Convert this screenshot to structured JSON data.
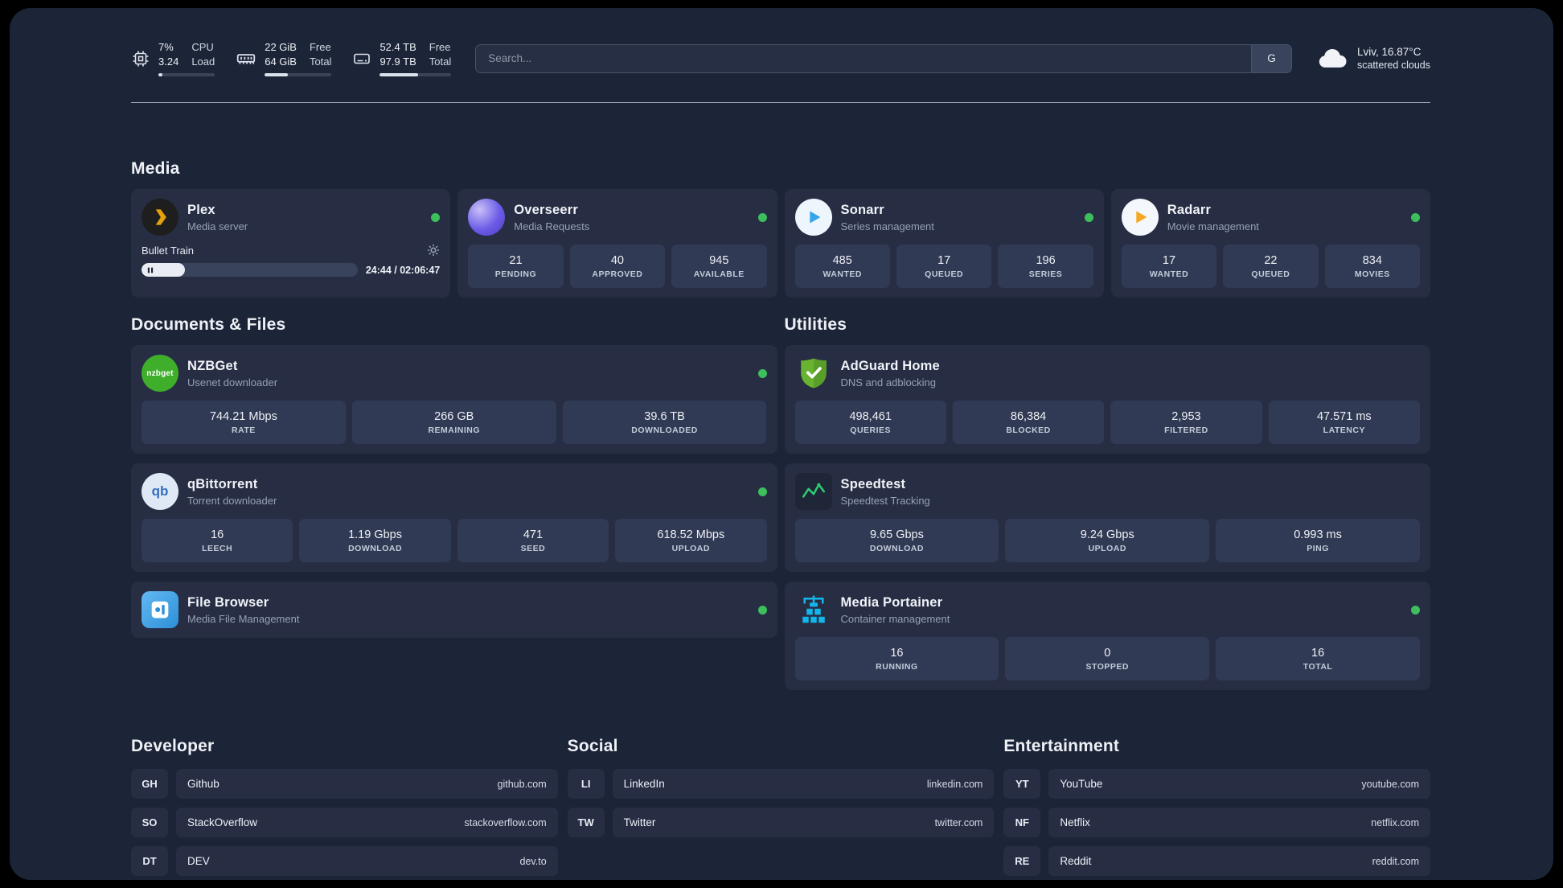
{
  "topbar": {
    "metrics": [
      {
        "value_top": "7%",
        "value_bottom": "3.24",
        "label_top": "CPU",
        "label_bottom": "Load",
        "progress_pct": 7
      },
      {
        "value_top": "22 GiB",
        "value_bottom": "64 GiB",
        "label_top": "Free",
        "label_bottom": "Total",
        "progress_pct": 34
      },
      {
        "value_top": "52.4 TB",
        "value_bottom": "97.9 TB",
        "label_top": "Free",
        "label_bottom": "Total",
        "progress_pct": 54
      }
    ],
    "search": {
      "placeholder": "Search...",
      "button_label": "G"
    },
    "weather": {
      "line1": "Lviv, 16.87°C",
      "line2": "scattered clouds"
    }
  },
  "sections": {
    "media": {
      "title": "Media",
      "plex": {
        "title": "Plex",
        "subtitle": "Media server",
        "now_playing": "Bullet Train",
        "time": "24:44 / 02:06:47",
        "progress_pct": 20
      },
      "overseerr": {
        "title": "Overseerr",
        "subtitle": "Media Requests",
        "stats": [
          {
            "value": "21",
            "label": "PENDING"
          },
          {
            "value": "40",
            "label": "APPROVED"
          },
          {
            "value": "945",
            "label": "AVAILABLE"
          }
        ]
      },
      "sonarr": {
        "title": "Sonarr",
        "subtitle": "Series management",
        "stats": [
          {
            "value": "485",
            "label": "WANTED"
          },
          {
            "value": "17",
            "label": "QUEUED"
          },
          {
            "value": "196",
            "label": "SERIES"
          }
        ]
      },
      "radarr": {
        "title": "Radarr",
        "subtitle": "Movie management",
        "stats": [
          {
            "value": "17",
            "label": "WANTED"
          },
          {
            "value": "22",
            "label": "QUEUED"
          },
          {
            "value": "834",
            "label": "MOVIES"
          }
        ]
      }
    },
    "documents": {
      "title": "Documents & Files",
      "nzbget": {
        "title": "NZBGet",
        "subtitle": "Usenet downloader",
        "icon_text": "nzbget",
        "stats": [
          {
            "value": "744.21 Mbps",
            "label": "RATE"
          },
          {
            "value": "266 GB",
            "label": "REMAINING"
          },
          {
            "value": "39.6 TB",
            "label": "DOWNLOADED"
          }
        ]
      },
      "qbittorrent": {
        "title": "qBittorrent",
        "subtitle": "Torrent downloader",
        "icon_text": "qb",
        "stats": [
          {
            "value": "16",
            "label": "LEECH"
          },
          {
            "value": "1.19 Gbps",
            "label": "DOWNLOAD"
          },
          {
            "value": "471",
            "label": "SEED"
          },
          {
            "value": "618.52 Mbps",
            "label": "UPLOAD"
          }
        ]
      },
      "filebrowser": {
        "title": "File Browser",
        "subtitle": "Media File Management"
      }
    },
    "utilities": {
      "title": "Utilities",
      "adguard": {
        "title": "AdGuard Home",
        "subtitle": "DNS and adblocking",
        "stats": [
          {
            "value": "498,461",
            "label": "QUERIES"
          },
          {
            "value": "86,384",
            "label": "BLOCKED"
          },
          {
            "value": "2,953",
            "label": "FILTERED"
          },
          {
            "value": "47.571 ms",
            "label": "LATENCY"
          }
        ]
      },
      "speedtest": {
        "title": "Speedtest",
        "subtitle": "Speedtest Tracking",
        "stats": [
          {
            "value": "9.65 Gbps",
            "label": "DOWNLOAD"
          },
          {
            "value": "9.24 Gbps",
            "label": "UPLOAD"
          },
          {
            "value": "0.993 ms",
            "label": "PING"
          }
        ]
      },
      "portainer": {
        "title": "Media Portainer",
        "subtitle": "Container management",
        "stats": [
          {
            "value": "16",
            "label": "RUNNING"
          },
          {
            "value": "0",
            "label": "STOPPED"
          },
          {
            "value": "16",
            "label": "TOTAL"
          }
        ]
      }
    },
    "links": {
      "developer": {
        "title": "Developer",
        "items": [
          {
            "abbr": "GH",
            "name": "Github",
            "domain": "github.com"
          },
          {
            "abbr": "SO",
            "name": "StackOverflow",
            "domain": "stackoverflow.com"
          },
          {
            "abbr": "DT",
            "name": "DEV",
            "domain": "dev.to"
          }
        ]
      },
      "social": {
        "title": "Social",
        "items": [
          {
            "abbr": "LI",
            "name": "LinkedIn",
            "domain": "linkedin.com"
          },
          {
            "abbr": "TW",
            "name": "Twitter",
            "domain": "twitter.com"
          }
        ]
      },
      "entertainment": {
        "title": "Entertainment",
        "items": [
          {
            "abbr": "YT",
            "name": "YouTube",
            "domain": "youtube.com"
          },
          {
            "abbr": "NF",
            "name": "Netflix",
            "domain": "netflix.com"
          },
          {
            "abbr": "RE",
            "name": "Reddit",
            "domain": "reddit.com"
          }
        ]
      }
    }
  },
  "colors": {
    "status_online": "#3cbf5c",
    "plex": "#e5a00d",
    "overseerr": "#6c5ce7",
    "sonarr": "#35a6e8",
    "radarr": "#f7a823",
    "nzbget": "#3eae2b",
    "qbittorrent": "#356ec0",
    "filebrowser": "#2d8fd8",
    "adguard": "#68b330",
    "speedtest": "#2ecc71",
    "portainer": "#13b5ea"
  }
}
